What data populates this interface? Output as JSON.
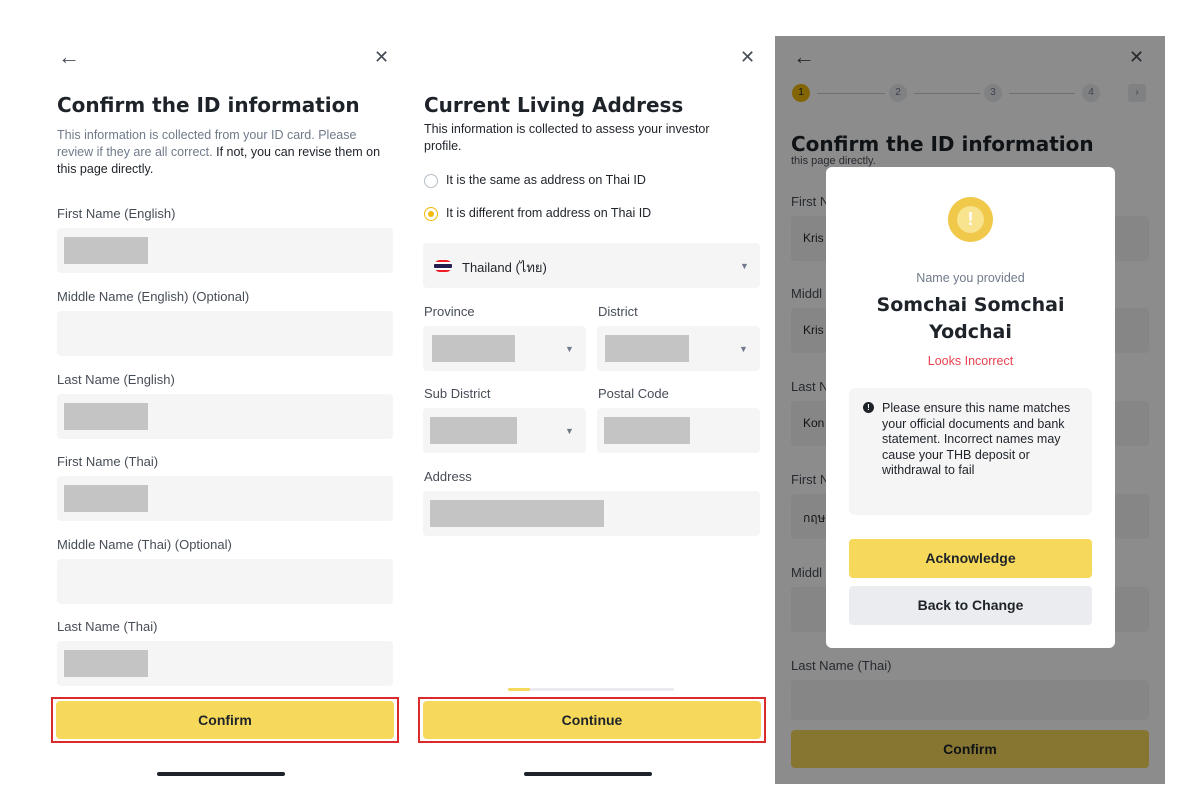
{
  "panel1": {
    "back_icon": "←",
    "close_icon": "✕",
    "title": "Confirm the ID information",
    "desc_gray": "This information is collected from your ID card. Please review if they are all correct.",
    "desc_dark": "If not, you can revise them on this page directly.",
    "fields": [
      {
        "label": "First Name (English)"
      },
      {
        "label": "Middle Name (English) (Optional)"
      },
      {
        "label": "Last Name (English)"
      },
      {
        "label": "First Name (Thai)"
      },
      {
        "label": "Middle Name (Thai) (Optional)"
      },
      {
        "label": "Last Name (Thai)"
      }
    ],
    "confirm_label": "Confirm"
  },
  "panel2": {
    "close_icon": "✕",
    "title": "Current Living Address",
    "desc": "This information is collected to assess your investor profile.",
    "radio_same": "It is the same as address on Thai ID",
    "radio_diff": "It is different from address on Thai ID",
    "country": "Thailand (ไทย)",
    "province_label": "Province",
    "district_label": "District",
    "subdistrict_label": "Sub District",
    "postal_label": "Postal Code",
    "address_label": "Address",
    "continue_label": "Continue"
  },
  "panel3": {
    "back_icon": "←",
    "close_icon": "✕",
    "steps": [
      "1",
      "2",
      "3",
      "4"
    ],
    "next_icon": "›",
    "title": "Confirm the ID information",
    "partial_text": "this page directly.",
    "bg_labels": {
      "first_en": "First N",
      "first_en_val": "Kris",
      "middle_en": "Middl",
      "middle_en_val": "Kris",
      "last_en": "Last N",
      "last_en_val": "Kon",
      "first_th": "First N",
      "first_th_val": "กฤษ",
      "middle_th": "Middl",
      "last_th": "Last Name (Thai)"
    },
    "confirm_label": "Confirm",
    "modal": {
      "warn_icon": "!",
      "subtitle": "Name you provided",
      "name_line1": "Somchai Somchai",
      "name_line2": "Yodchai",
      "status": "Looks Incorrect",
      "note": "Please ensure this name matches your official documents and bank statement. Incorrect names may cause your THB deposit or withdrawal to fail",
      "acknowledge_label": "Acknowledge",
      "back_label": "Back to Change"
    }
  },
  "colors": {
    "accent_yellow": "#f6d85b",
    "brand_yellow": "#f0b90b",
    "error_red": "#e8424e",
    "highlight_box": "#d92b2b"
  }
}
